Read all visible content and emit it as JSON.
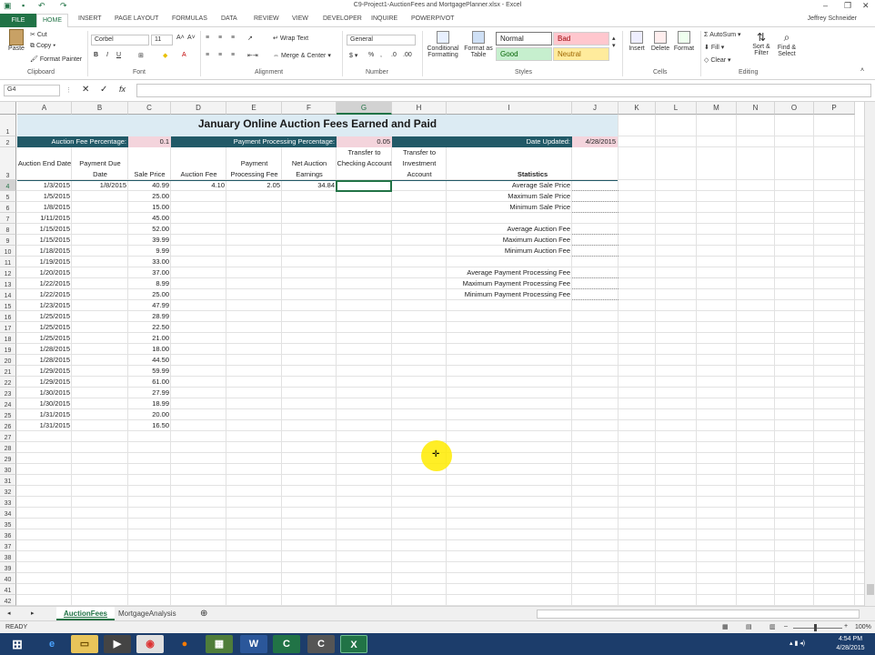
{
  "window": {
    "title": "C9-Project1-AuctionFees and MortgagePlanner.xlsx - Excel",
    "user": "Jeffrey Schneider"
  },
  "ribbon_tabs": [
    "FILE",
    "HOME",
    "INSERT",
    "PAGE LAYOUT",
    "FORMULAS",
    "DATA",
    "REVIEW",
    "VIEW",
    "DEVELOPER",
    "INQUIRE",
    "POWERPIVOT"
  ],
  "ribbon": {
    "clipboard": {
      "paste": "Paste",
      "cut": "Cut",
      "copy": "Copy",
      "format_painter": "Format Painter",
      "label": "Clipboard"
    },
    "font": {
      "name": "Corbel",
      "size": "11",
      "label": "Font"
    },
    "alignment": {
      "wrap": "Wrap Text",
      "merge": "Merge & Center",
      "label": "Alignment"
    },
    "number": {
      "format": "General",
      "label": "Number"
    },
    "styles": {
      "conditional": "Conditional Formatting",
      "format_table": "Format as Table",
      "normal": "Normal",
      "bad": "Bad",
      "good": "Good",
      "neutral": "Neutral",
      "label": "Styles"
    },
    "cells": {
      "insert": "Insert",
      "delete": "Delete",
      "format": "Format",
      "label": "Cells"
    },
    "editing": {
      "autosum": "AutoSum",
      "fill": "Fill",
      "clear": "Clear",
      "sort": "Sort & Filter",
      "find": "Find & Select",
      "label": "Editing"
    }
  },
  "formula_bar": {
    "name_box": "G4",
    "fx": "fx",
    "content": ""
  },
  "columns": [
    "A",
    "B",
    "C",
    "D",
    "E",
    "F",
    "G",
    "H",
    "I",
    "J",
    "K",
    "L",
    "M",
    "N",
    "O",
    "P"
  ],
  "sheet": {
    "title": "January Online Auction Fees Earned and Paid",
    "auction_fee_label": "Auction Fee Percentage:",
    "auction_fee_value": "0.1",
    "processing_label": "Payment Processing Percentage:",
    "processing_value": "0.05",
    "date_label": "Date Updated:",
    "date_value": "4/28/2015",
    "headers": {
      "a": "Auction End Date",
      "b": "Payment Due Date",
      "c": "Sale Price",
      "d": "Auction Fee",
      "e": "Payment Processing Fee",
      "f": "Net Auction Earnings",
      "g": "Transfer to Checking Account",
      "h": "Transfer to Investment Account",
      "i": "Statistics"
    },
    "rows": [
      {
        "a": "1/3/2015",
        "b": "1/8/2015",
        "c": "40.99",
        "d": "4.10",
        "e": "2.05",
        "f": "34.84"
      },
      {
        "a": "1/5/2015",
        "b": "",
        "c": "25.00",
        "d": "",
        "e": "",
        "f": ""
      },
      {
        "a": "1/8/2015",
        "b": "",
        "c": "15.00",
        "d": "",
        "e": "",
        "f": ""
      },
      {
        "a": "1/11/2015",
        "b": "",
        "c": "45.00",
        "d": "",
        "e": "",
        "f": ""
      },
      {
        "a": "1/15/2015",
        "b": "",
        "c": "52.00",
        "d": "",
        "e": "",
        "f": ""
      },
      {
        "a": "1/15/2015",
        "b": "",
        "c": "39.99",
        "d": "",
        "e": "",
        "f": ""
      },
      {
        "a": "1/18/2015",
        "b": "",
        "c": "9.99",
        "d": "",
        "e": "",
        "f": ""
      },
      {
        "a": "1/19/2015",
        "b": "",
        "c": "33.00",
        "d": "",
        "e": "",
        "f": ""
      },
      {
        "a": "1/20/2015",
        "b": "",
        "c": "37.00",
        "d": "",
        "e": "",
        "f": ""
      },
      {
        "a": "1/22/2015",
        "b": "",
        "c": "8.99",
        "d": "",
        "e": "",
        "f": ""
      },
      {
        "a": "1/22/2015",
        "b": "",
        "c": "25.00",
        "d": "",
        "e": "",
        "f": ""
      },
      {
        "a": "1/23/2015",
        "b": "",
        "c": "47.99",
        "d": "",
        "e": "",
        "f": ""
      },
      {
        "a": "1/25/2015",
        "b": "",
        "c": "28.99",
        "d": "",
        "e": "",
        "f": ""
      },
      {
        "a": "1/25/2015",
        "b": "",
        "c": "22.50",
        "d": "",
        "e": "",
        "f": ""
      },
      {
        "a": "1/25/2015",
        "b": "",
        "c": "21.00",
        "d": "",
        "e": "",
        "f": ""
      },
      {
        "a": "1/28/2015",
        "b": "",
        "c": "18.00",
        "d": "",
        "e": "",
        "f": ""
      },
      {
        "a": "1/28/2015",
        "b": "",
        "c": "44.50",
        "d": "",
        "e": "",
        "f": ""
      },
      {
        "a": "1/29/2015",
        "b": "",
        "c": "59.99",
        "d": "",
        "e": "",
        "f": ""
      },
      {
        "a": "1/29/2015",
        "b": "",
        "c": "61.00",
        "d": "",
        "e": "",
        "f": ""
      },
      {
        "a": "1/30/2015",
        "b": "",
        "c": "27.99",
        "d": "",
        "e": "",
        "f": ""
      },
      {
        "a": "1/30/2015",
        "b": "",
        "c": "18.99",
        "d": "",
        "e": "",
        "f": ""
      },
      {
        "a": "1/31/2015",
        "b": "",
        "c": "20.00",
        "d": "",
        "e": "",
        "f": ""
      },
      {
        "a": "1/31/2015",
        "b": "",
        "c": "16.50",
        "d": "",
        "e": "",
        "f": ""
      }
    ],
    "statistics": [
      {
        "row": 4,
        "label": "Average Sale Price"
      },
      {
        "row": 5,
        "label": "Maximum Sale Price"
      },
      {
        "row": 6,
        "label": "Minimum Sale Price"
      },
      {
        "row": 8,
        "label": "Average Auction Fee"
      },
      {
        "row": 9,
        "label": "Maximum Auction Fee"
      },
      {
        "row": 10,
        "label": "Minimum Auction Fee"
      },
      {
        "row": 12,
        "label": "Average Payment Processing Fee"
      },
      {
        "row": 13,
        "label": "Maximum Payment Processing Fee"
      },
      {
        "row": 14,
        "label": "Minimum Payment Processing Fee"
      }
    ]
  },
  "sheet_tabs": [
    "AuctionFees",
    "MortgageAnalysis"
  ],
  "status": {
    "mode": "READY",
    "zoom": "100%"
  },
  "taskbar": {
    "time": "4:54 PM",
    "date": "4/28/2015"
  },
  "colors": {
    "excel_green": "#217346",
    "teal_header": "#215967",
    "pink_input": "#f4d4dc",
    "blue_title": "#dcebf3"
  }
}
